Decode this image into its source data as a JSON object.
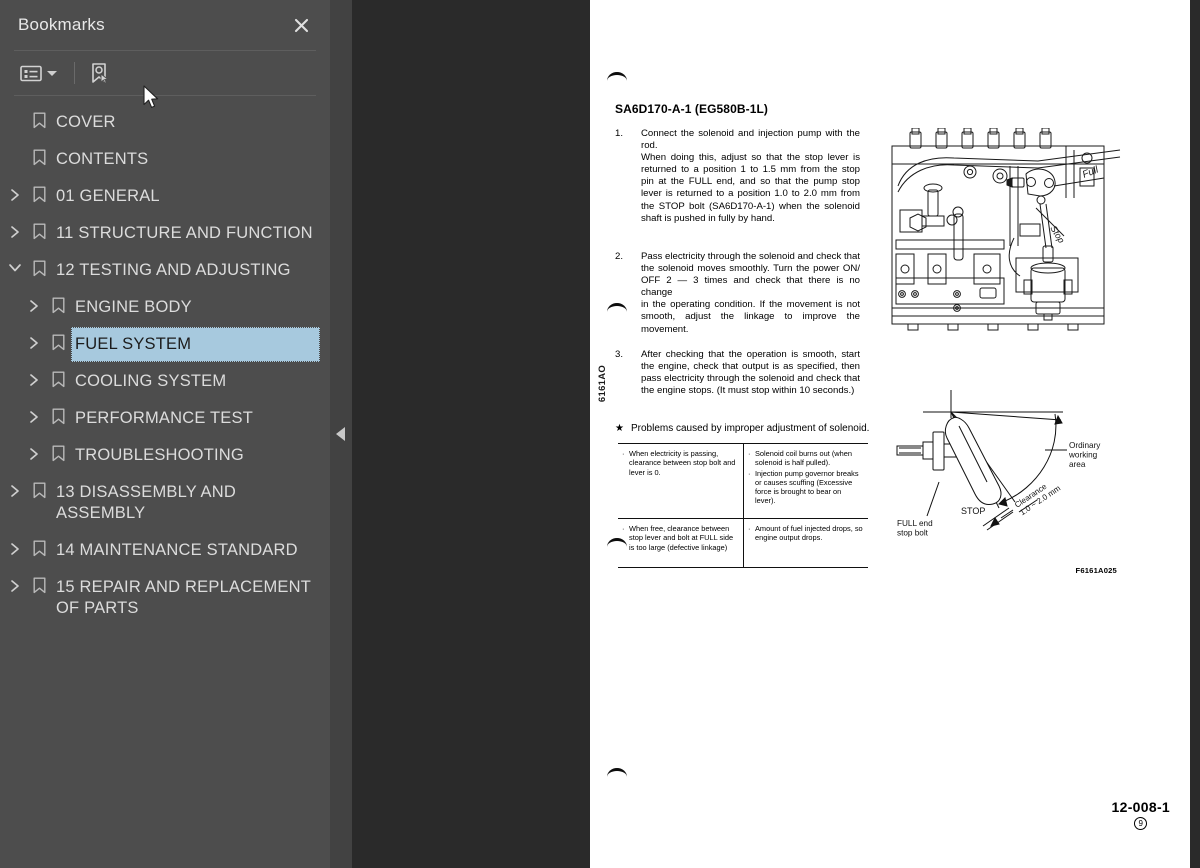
{
  "panel": {
    "title": "Bookmarks",
    "close_icon": "close-icon",
    "toolbar": {
      "listview_icon": "list-view-icon",
      "dropdown_caret_icon": "chevron-down-icon",
      "new-bookmark_icon": "bookmark-pointer-icon"
    },
    "items": [
      {
        "label": "COVER",
        "depth": 0,
        "expandable": false,
        "expanded": false,
        "selected": false
      },
      {
        "label": "CONTENTS",
        "depth": 0,
        "expandable": false,
        "expanded": false,
        "selected": false
      },
      {
        "label": "01 GENERAL",
        "depth": 0,
        "expandable": true,
        "expanded": false,
        "selected": false
      },
      {
        "label": "11 STRUCTURE AND FUNCTION",
        "depth": 0,
        "expandable": true,
        "expanded": false,
        "selected": false
      },
      {
        "label": "12 TESTING AND ADJUSTING",
        "depth": 0,
        "expandable": true,
        "expanded": true,
        "selected": false
      },
      {
        "label": "ENGINE BODY",
        "depth": 1,
        "expandable": true,
        "expanded": false,
        "selected": false
      },
      {
        "label": "FUEL SYSTEM",
        "depth": 1,
        "expandable": true,
        "expanded": false,
        "selected": true
      },
      {
        "label": "COOLING SYSTEM",
        "depth": 1,
        "expandable": true,
        "expanded": false,
        "selected": false
      },
      {
        "label": "PERFORMANCE TEST",
        "depth": 1,
        "expandable": true,
        "expanded": false,
        "selected": false
      },
      {
        "label": "TROUBLESHOOTING",
        "depth": 1,
        "expandable": true,
        "expanded": false,
        "selected": false
      },
      {
        "label": "13 DISASSEMBLY AND ASSEMBLY",
        "depth": 0,
        "expandable": true,
        "expanded": false,
        "selected": false
      },
      {
        "label": "14 MAINTENANCE STANDARD",
        "depth": 0,
        "expandable": true,
        "expanded": false,
        "selected": false
      },
      {
        "label": "15 REPAIR AND REPLACEMENT OF PARTS",
        "depth": 0,
        "expandable": true,
        "expanded": false,
        "selected": false
      }
    ]
  },
  "collapse_handle": {
    "icon": "chevron-left-icon"
  },
  "document": {
    "side_code": "6161AO",
    "title": "SA6D170-A-1 (EG580B-1L)",
    "steps": [
      {
        "num": "1.",
        "lines": [
          "Connect the solenoid and injection pump with the",
          "rod.",
          "When doing this, adjust so that the stop lever is",
          "returned to a position 1 to 1.5 mm from the stop",
          "pin at the FULL end, and so that the pump stop",
          "lever is returned to a position 1.0 to 2.0 mm from",
          "the STOP bolt (SA6D170-A-1) when the solenoid",
          "shaft is pushed in fully by hand."
        ]
      },
      {
        "num": "2.",
        "lines": [
          "Pass electricity through the solenoid and check that",
          "the solenoid moves smoothly. Turn the power ON/",
          "OFF 2 — 3 times and check that there is no change",
          "in the operating condition. If the movement is not",
          "smooth, adjust the linkage to improve the",
          "movement."
        ]
      },
      {
        "num": "3.",
        "lines": [
          "After checking that the operation is smooth, start",
          "the engine, check that output is as specified, then",
          "pass electricity through the solenoid and check that",
          "the engine stops. (It must stop within 10 seconds.)"
        ]
      }
    ],
    "star_note": {
      "star": "★",
      "text": "Problems caused by improper adjustment of solenoid."
    },
    "table": {
      "rows": [
        {
          "cause": [
            "When electricity is passing, clearance between stop bolt and lever is 0."
          ],
          "effect": [
            "Solenoid coil burns out (when solenoid is half pulled).",
            "Injection pump governor breaks or causes scuffing (Excessive force is brought to bear on lever)."
          ]
        },
        {
          "cause": [
            "When free, clearance between stop lever and bolt at FULL side is too large (defective linkage)"
          ],
          "effect": [
            "Amount of fuel injected drops, so engine output drops."
          ]
        }
      ]
    },
    "figure_top": {
      "label_full": "Full",
      "label_stop": "Stop"
    },
    "figure_bottom": {
      "label_working_area": "Ordinary working area",
      "label_clearance": "Clearance 1.0 ~ 2.0 mm",
      "label_stop": "STOP",
      "label_full_end_bolt": "FULL end stop bolt",
      "figure_id": "F6161A025"
    },
    "page_number": "12-008-1",
    "page_number_circled": "9"
  }
}
